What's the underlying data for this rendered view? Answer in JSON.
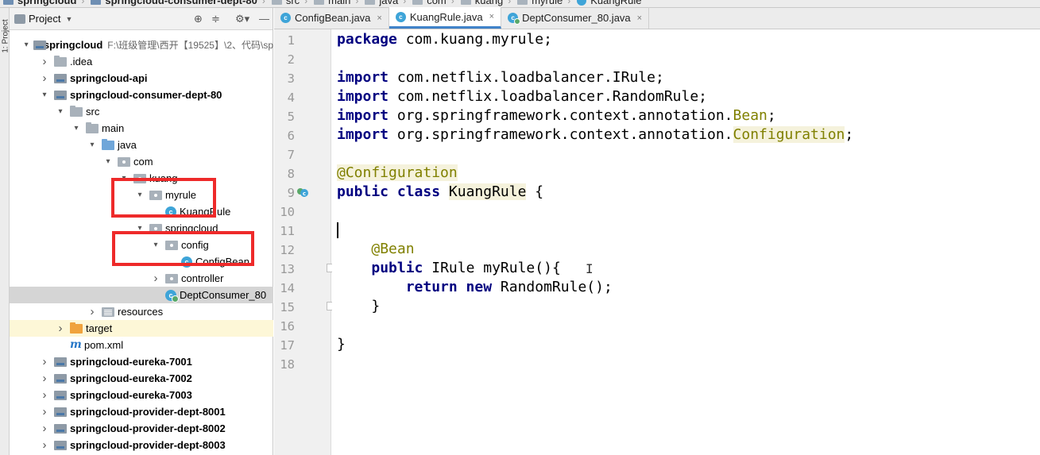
{
  "breadcrumb": {
    "items": [
      "springcloud",
      "springcloud-consumer-dept-80",
      "src",
      "main",
      "java",
      "com",
      "kuang",
      "myrule",
      "KuangRule"
    ]
  },
  "toolstrip": {
    "label": "1: Project"
  },
  "project_panel": {
    "title": "Project",
    "root": {
      "name": "springcloud",
      "path": "F:\\班级管理\\西开【19525】\\2、代码\\sp"
    },
    "tree": [
      {
        "label": "springcloud",
        "depth": 0,
        "icon": "module",
        "expanded": true,
        "bold": true
      },
      {
        "label": ".idea",
        "depth": 1,
        "icon": "folder",
        "expanded": false,
        "bold": false
      },
      {
        "label": "springcloud-api",
        "depth": 1,
        "icon": "module",
        "expanded": false,
        "bold": true
      },
      {
        "label": "springcloud-consumer-dept-80",
        "depth": 1,
        "icon": "module",
        "expanded": true,
        "bold": true
      },
      {
        "label": "src",
        "depth": 2,
        "icon": "folder",
        "expanded": true,
        "bold": false
      },
      {
        "label": "main",
        "depth": 3,
        "icon": "folder",
        "expanded": true,
        "bold": false
      },
      {
        "label": "java",
        "depth": 4,
        "icon": "folder-blue",
        "expanded": true,
        "bold": false
      },
      {
        "label": "com",
        "depth": 5,
        "icon": "pkg",
        "expanded": true,
        "bold": false
      },
      {
        "label": "kuang",
        "depth": 6,
        "icon": "pkg",
        "expanded": true,
        "bold": false
      },
      {
        "label": "myrule",
        "depth": 7,
        "icon": "pkg",
        "expanded": true,
        "bold": false
      },
      {
        "label": "KuangRule",
        "depth": 8,
        "icon": "class",
        "expanded": null,
        "bold": false
      },
      {
        "label": "springcloud",
        "depth": 7,
        "icon": "pkg",
        "expanded": true,
        "bold": false
      },
      {
        "label": "config",
        "depth": 8,
        "icon": "pkg",
        "expanded": true,
        "bold": false
      },
      {
        "label": "ConfigBean",
        "depth": 9,
        "icon": "class",
        "expanded": null,
        "bold": false
      },
      {
        "label": "controller",
        "depth": 8,
        "icon": "pkg",
        "expanded": false,
        "bold": false
      },
      {
        "label": "DeptConsumer_80",
        "depth": 8,
        "icon": "class-run",
        "expanded": null,
        "bold": false
      },
      {
        "label": "resources",
        "depth": 4,
        "icon": "res",
        "expanded": false,
        "bold": false
      },
      {
        "label": "target",
        "depth": 2,
        "icon": "folder-orange",
        "expanded": false,
        "bold": false
      },
      {
        "label": "pom.xml",
        "depth": 2,
        "icon": "maven",
        "expanded": null,
        "bold": false
      },
      {
        "label": "springcloud-eureka-7001",
        "depth": 1,
        "icon": "module",
        "expanded": false,
        "bold": true
      },
      {
        "label": "springcloud-eureka-7002",
        "depth": 1,
        "icon": "module",
        "expanded": false,
        "bold": true
      },
      {
        "label": "springcloud-eureka-7003",
        "depth": 1,
        "icon": "module",
        "expanded": false,
        "bold": true
      },
      {
        "label": "springcloud-provider-dept-8001",
        "depth": 1,
        "icon": "module",
        "expanded": false,
        "bold": true
      },
      {
        "label": "springcloud-provider-dept-8002",
        "depth": 1,
        "icon": "module",
        "expanded": false,
        "bold": true
      },
      {
        "label": "springcloud-provider-dept-8003",
        "depth": 1,
        "icon": "module",
        "expanded": false,
        "bold": true
      }
    ],
    "selected_item": "DeptConsumer_80"
  },
  "editor": {
    "tabs": [
      {
        "label": "ConfigBean.java",
        "active": false,
        "icon": "class-icon"
      },
      {
        "label": "KuangRule.java",
        "active": true,
        "icon": "class-icon"
      },
      {
        "label": "DeptConsumer_80.java",
        "active": false,
        "icon": "run-class-icon"
      }
    ],
    "current_line": 11,
    "lines": [
      {
        "n": "1",
        "tokens": [
          [
            "kw",
            "package"
          ],
          [
            "t",
            " com.kuang.myrule;"
          ]
        ]
      },
      {
        "n": "2",
        "tokens": []
      },
      {
        "n": "3",
        "tokens": [
          [
            "kw",
            "import"
          ],
          [
            "t",
            " com.netflix.loadbalancer.IRule;"
          ]
        ]
      },
      {
        "n": "4",
        "tokens": [
          [
            "kw",
            "import"
          ],
          [
            "t",
            " com.netflix.loadbalancer.RandomRule;"
          ]
        ]
      },
      {
        "n": "5",
        "tokens": [
          [
            "kw",
            "import"
          ],
          [
            "t",
            " org.springframework.context.annotation."
          ],
          [
            "ann",
            "Bean"
          ],
          [
            "t",
            ";"
          ]
        ]
      },
      {
        "n": "6",
        "tokens": [
          [
            "kw",
            "import"
          ],
          [
            "t",
            " org.springframework.context.annotation."
          ],
          [
            "annhl",
            "Configuration"
          ],
          [
            "t",
            ";"
          ]
        ]
      },
      {
        "n": "7",
        "tokens": []
      },
      {
        "n": "8",
        "tokens": [
          [
            "annhl",
            "@Configuration"
          ]
        ]
      },
      {
        "n": "9",
        "tokens": [
          [
            "kw",
            "public class"
          ],
          [
            "t",
            " "
          ],
          [
            "hl",
            "KuangRule"
          ],
          [
            "t",
            " {"
          ]
        ]
      },
      {
        "n": "10",
        "tokens": []
      },
      {
        "n": "11",
        "tokens": []
      },
      {
        "n": "12",
        "tokens": [
          [
            "t",
            "    "
          ],
          [
            "ann",
            "@Bean"
          ]
        ]
      },
      {
        "n": "13",
        "tokens": [
          [
            "t",
            "    "
          ],
          [
            "kw",
            "public"
          ],
          [
            "t",
            " IRule myRule(){"
          ]
        ]
      },
      {
        "n": "14",
        "tokens": [
          [
            "t",
            "        "
          ],
          [
            "kw",
            "return new"
          ],
          [
            "t",
            " RandomRule();"
          ]
        ]
      },
      {
        "n": "15",
        "tokens": [
          [
            "t",
            "    }"
          ]
        ]
      },
      {
        "n": "16",
        "tokens": []
      },
      {
        "n": "17",
        "tokens": [
          [
            "t",
            "}"
          ]
        ]
      },
      {
        "n": "18",
        "tokens": []
      }
    ]
  },
  "colors": {
    "keyword": "#000080",
    "annotation": "#808000",
    "highlight_box": "#ee2a2a",
    "active_tab_accent": "#4083c9"
  }
}
